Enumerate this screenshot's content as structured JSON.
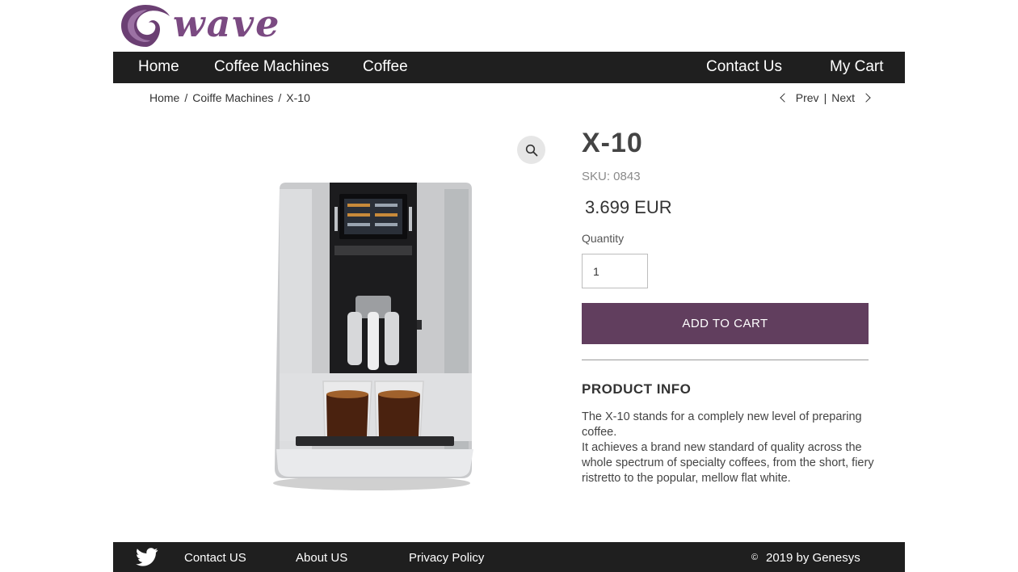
{
  "brand": {
    "logo_text": "wave",
    "logo_color": "#7b4a82"
  },
  "nav": {
    "items": [
      {
        "label": "Home"
      },
      {
        "label": "Coffee Machines"
      },
      {
        "label": "Coffee"
      },
      {
        "label": "Contact Us"
      },
      {
        "label": "My Cart"
      }
    ]
  },
  "breadcrumb": {
    "items": [
      "Home",
      "Coiffe Machines",
      "X-10"
    ],
    "separator": "/"
  },
  "pager": {
    "prev": "Prev",
    "divider": "|",
    "next": "Next"
  },
  "product": {
    "name": "X-10",
    "sku": "SKU: 0843",
    "price": "3.699 EUR",
    "quantity_label": "Quantity",
    "quantity_value": "1",
    "add_to_cart": "ADD TO CART",
    "info_heading": "PRODUCT INFO",
    "info_line1": "The X-10 stands for a complely new level of preparing coffee.",
    "info_line2": "It achieves a brand new standard of quality across the whole spectrum of specialty coffees, from the short, fiery ristretto to the popular, mellow flat white."
  },
  "footer": {
    "contact": "Contact US",
    "about": "About US",
    "privacy": "Privacy Policy",
    "copyright_symbol": "©",
    "copyright": "2019 by Genesys"
  },
  "colors": {
    "nav_bg": "#1f1f1f",
    "accent": "#613e5e",
    "text": "#333333"
  },
  "icons": [
    "wave-logo-icon",
    "chevron-left-icon",
    "chevron-right-icon",
    "zoom-icon",
    "twitter-icon"
  ]
}
